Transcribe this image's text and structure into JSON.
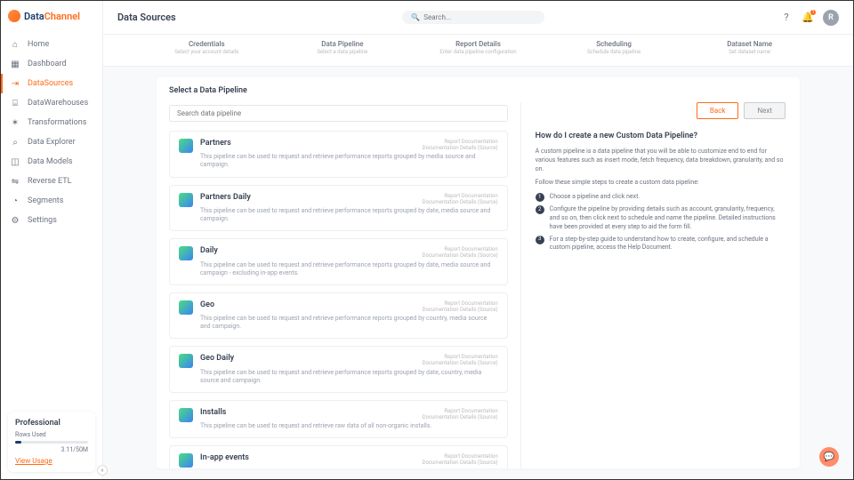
{
  "brand": {
    "part1": "Data",
    "part2": "Channel"
  },
  "page_title": "Data Sources",
  "search_placeholder": "Search...",
  "avatar_initial": "R",
  "notif_count": "1",
  "nav": [
    {
      "icon": "⌂",
      "label": "Home"
    },
    {
      "icon": "▦",
      "label": "Dashboard"
    },
    {
      "icon": "⇥",
      "label": "DataSources",
      "active": true
    },
    {
      "icon": "⌸",
      "label": "DataWarehouses"
    },
    {
      "icon": "✶",
      "label": "Transformations"
    },
    {
      "icon": "⌕",
      "label": "Data Explorer"
    },
    {
      "icon": "◫",
      "label": "Data Models"
    },
    {
      "icon": "⇋",
      "label": "Reverse ETL"
    },
    {
      "icon": "◔",
      "label": "Segments"
    },
    {
      "icon": "⚙",
      "label": "Settings"
    }
  ],
  "usage": {
    "tier": "Professional",
    "label": "Rows Used",
    "value": "3.11/50M",
    "link": "View Usage"
  },
  "steps": [
    {
      "t": "Credentials",
      "s": "Select your account details"
    },
    {
      "t": "Data Pipeline",
      "s": "Select a data pipeline"
    },
    {
      "t": "Report Details",
      "s": "Enter data pipeline configuration"
    },
    {
      "t": "Scheduling",
      "s": "Schedule data pipeline"
    },
    {
      "t": "Dataset Name",
      "s": "Set dataset name"
    }
  ],
  "panel_title": "Select a Data Pipeline",
  "pipe_search_placeholder": "Search data pipeline",
  "link1": "Report Documentation",
  "link2": "Documentation Details (Source)",
  "pipelines": [
    {
      "name": "Partners",
      "desc": "This pipeline can be used to request and retrieve performance reports grouped by media source and campaign."
    },
    {
      "name": "Partners Daily",
      "desc": "This pipeline can be used to request and retrieve performance reports grouped by date, media source and campaign."
    },
    {
      "name": "Daily",
      "desc": "This pipeline can be used to request and retrieve performance reports grouped by date, media source and campaign - excluding in-app events."
    },
    {
      "name": "Geo",
      "desc": "This pipeline can be used to request and retrieve performance reports grouped by country, media source and campaign."
    },
    {
      "name": "Geo Daily",
      "desc": "This pipeline can be used to request and retrieve performance reports grouped by date, country, media source and campaign."
    },
    {
      "name": "Installs",
      "desc": "This pipeline can be used to request and retrieve raw data of all non-organic installs."
    },
    {
      "name": "In-app events",
      "desc": ""
    }
  ],
  "buttons": {
    "back": "Back",
    "next": "Next"
  },
  "help": {
    "title": "How do I create a new Custom Data Pipeline?",
    "intro": "A custom pipeline is a data pipeline that you will be able to customize end to end for various features such as insert mode, fetch frequency, data breakdown, granularity, and so on.",
    "lead": "Follow these simple steps to create a custom data pipeline:",
    "steps": [
      "Choose a pipeline and click next.",
      "Configure the pipeline by providing details such as account, granularity, frequency, and so on, then click next to schedule and name the pipeline. Detailed instructions have been provided at every step to aid the form fill.",
      "For a step-by-step guide to understand how to create, configure, and schedule a custom pipeline, access the Help Document."
    ]
  }
}
